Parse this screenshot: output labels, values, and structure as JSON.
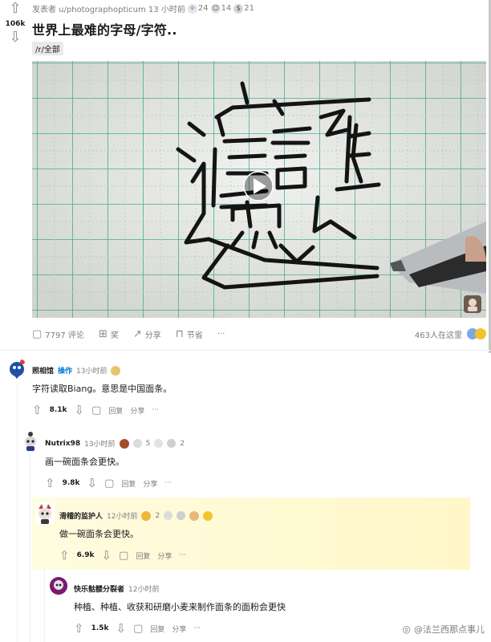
{
  "post": {
    "score": "106k",
    "meta_prefix": "发表者 u/photographopticum 13 小时前",
    "awards": [
      {
        "icon": "helpful-award-icon",
        "count": "24"
      },
      {
        "icon": "wholesome-award-icon",
        "count": "14"
      },
      {
        "icon": "silver-award-icon",
        "count": "21"
      }
    ],
    "title": "世界上最难的字母/字符..",
    "flair": "/r/全部",
    "actions": {
      "comments": "7797 评论",
      "award": "奖",
      "share": "分享",
      "save": "节省",
      "more": "···"
    },
    "online": "463人在这里"
  },
  "comments": [
    {
      "name": "照相馆",
      "op": "操作",
      "time": "13小时前",
      "body": "字符读取Biang。意思是中国面条。",
      "score": "8.1k",
      "reply": "回复",
      "share": "分享",
      "more": "···"
    },
    {
      "name": "Nutrix98",
      "time": "13小时前",
      "awards": [
        {
          "count": "5"
        },
        {
          "count": ""
        },
        {
          "count": "2"
        }
      ],
      "body": "画一碗面条会更快。",
      "score": "9.8k",
      "reply": "回复",
      "share": "分享",
      "more": "···"
    },
    {
      "name": "滑稽的监护人",
      "time": "12小时前",
      "awards": [
        {
          "count": "2"
        }
      ],
      "body": "做一碗面条会更快。",
      "score": "6.9k",
      "reply": "回复",
      "share": "分享",
      "more": "···"
    },
    {
      "name": "快乐骷髅分裂者",
      "time": "12小时前",
      "body": "种植、种植、收获和研磨小麦来制作面条的面粉会更快",
      "score": "1.5k",
      "reply": "回复",
      "share": "分享",
      "more": "···"
    }
  ],
  "watermark": "@法兰西那点事儿",
  "colors": {
    "op_blue": "#0079d3",
    "muted": "#7c7c7c",
    "highlight": "#fff7c8"
  }
}
